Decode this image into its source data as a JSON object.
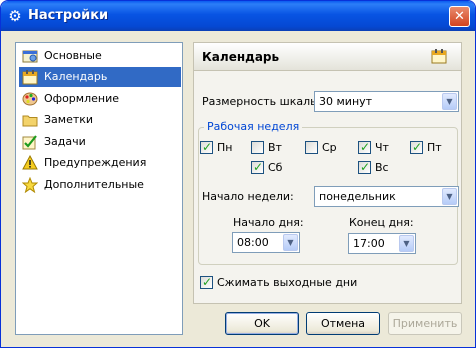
{
  "window": {
    "title": "Настройки",
    "icon": "gear-icon",
    "close_icon": "close-icon",
    "close_symbol": "✕"
  },
  "nav": {
    "items": [
      {
        "label": "Основные",
        "icon": "settings-page-icon",
        "selected": false
      },
      {
        "label": "Календарь",
        "icon": "calendar-icon",
        "selected": true
      },
      {
        "label": "Оформление",
        "icon": "palette-icon",
        "selected": false
      },
      {
        "label": "Заметки",
        "icon": "folder-icon",
        "selected": false
      },
      {
        "label": "Задачи",
        "icon": "task-checkbox-icon",
        "selected": false
      },
      {
        "label": "Предупреждения",
        "icon": "warning-icon",
        "selected": false
      },
      {
        "label": "Дополнительные",
        "icon": "star-icon",
        "selected": false
      }
    ]
  },
  "panel": {
    "title": "Календарь",
    "icon": "calendar-icon",
    "scale_label": "Размерность шкалы:",
    "scale_value": "30 минут",
    "workweek_title": "Рабочая неделя",
    "days": [
      {
        "label": "Пн",
        "checked": true
      },
      {
        "label": "Вт",
        "checked": false
      },
      {
        "label": "Ср",
        "checked": false
      },
      {
        "label": "Чт",
        "checked": true
      },
      {
        "label": "Пт",
        "checked": true
      },
      {
        "label": "Сб",
        "checked": true
      },
      {
        "label": "Вс",
        "checked": true
      }
    ],
    "week_start_label": "Начало недели:",
    "week_start_value": "понедельник",
    "day_start_label": "Начало дня:",
    "day_start_value": "08:00",
    "day_end_label": "Конец дня:",
    "day_end_value": "17:00",
    "compress_weekends_label": "Сжимать выходные дни",
    "compress_weekends_checked": true
  },
  "buttons": {
    "ok": "OK",
    "cancel": "Отмена",
    "apply": "Применить"
  },
  "symbols": {
    "check": "✓",
    "dropdown": "▼"
  },
  "colors": {
    "titlebar": "#0a5bf0",
    "selection": "#316ac5",
    "group_title": "#0046d5",
    "checkmark": "#21a121"
  }
}
